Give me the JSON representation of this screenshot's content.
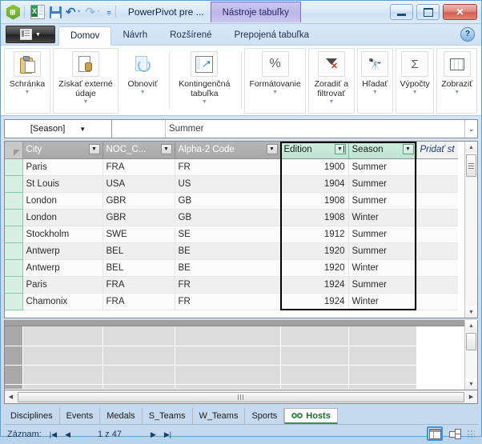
{
  "titlebar": {
    "app_title": "PowerPivot pre ...",
    "context_tab": "Nástroje tabuľky",
    "icons": {
      "powerpivot": "powerpivot-logo-icon",
      "excel": "excel-icon",
      "save": "save-icon",
      "undo": "undo-icon",
      "redo": "redo-icon",
      "qat_more": "quick-access-toolbar-more-icon"
    },
    "window_controls": {
      "minimize": "minimize-icon",
      "maximize": "maximize-icon",
      "close": "✕"
    }
  },
  "ribbon": {
    "file_button": "file-menu-button",
    "tabs": [
      {
        "label": "Domov",
        "active": true
      },
      {
        "label": "Návrh",
        "active": false
      },
      {
        "label": "Rozšírené",
        "active": false
      },
      {
        "label": "Prepojená tabuľka",
        "active": false
      }
    ],
    "help": "?",
    "groups": [
      {
        "label": "Schránka",
        "icon": "clipboard-icon",
        "has_caret": true
      },
      {
        "label": "Získať externé údaje",
        "icon": "get-external-data-icon",
        "has_caret": true
      },
      {
        "label": "Obnoviť",
        "icon": "refresh-icon",
        "has_caret": true
      },
      {
        "label": "Kontingenčná tabuľka",
        "icon": "pivot-table-icon",
        "has_caret": true
      },
      {
        "label": "Formátovanie",
        "icon": "percent-icon",
        "has_caret": true
      },
      {
        "label": "Zoradiť a filtrovať",
        "icon": "clear-filter-icon",
        "has_caret": true
      },
      {
        "label": "Hľadať",
        "icon": "binoculars-icon",
        "has_caret": true
      },
      {
        "label": "Výpočty",
        "icon": "autosum-sigma-icon",
        "has_caret": true
      },
      {
        "label": "Zobraziť",
        "icon": "view-grid-icon",
        "has_caret": true
      }
    ]
  },
  "formula_bar": {
    "name_box": "[Season]",
    "name_box_caret": "▼",
    "value": "Summer",
    "expand": "⌄"
  },
  "table": {
    "columns": [
      {
        "label": "City",
        "selected": false,
        "sorted": false,
        "align": "left"
      },
      {
        "label": "NOC_C...",
        "selected": false,
        "sorted": false,
        "align": "left"
      },
      {
        "label": "Alpha-2 Code",
        "selected": false,
        "sorted": false,
        "align": "left"
      },
      {
        "label": "Edition",
        "selected": true,
        "sorted": true,
        "align": "right"
      },
      {
        "label": "Season",
        "selected": true,
        "sorted": false,
        "align": "left"
      }
    ],
    "add_column_label": "Pridať st",
    "rows": [
      {
        "City": "Paris",
        "NOC_C": "FRA",
        "Alpha2": "FR",
        "Edition": "1900",
        "Season": "Summer"
      },
      {
        "City": "St Louis",
        "NOC_C": "USA",
        "Alpha2": "US",
        "Edition": "1904",
        "Season": "Summer"
      },
      {
        "City": "London",
        "NOC_C": "GBR",
        "Alpha2": "GB",
        "Edition": "1908",
        "Season": "Summer"
      },
      {
        "City": "London",
        "NOC_C": "GBR",
        "Alpha2": "GB",
        "Edition": "1908",
        "Season": "Winter"
      },
      {
        "City": "Stockholm",
        "NOC_C": "SWE",
        "Alpha2": "SE",
        "Edition": "1912",
        "Season": "Summer"
      },
      {
        "City": "Antwerp",
        "NOC_C": "BEL",
        "Alpha2": "BE",
        "Edition": "1920",
        "Season": "Summer"
      },
      {
        "City": "Antwerp",
        "NOC_C": "BEL",
        "Alpha2": "BE",
        "Edition": "1920",
        "Season": "Winter"
      },
      {
        "City": "Paris",
        "NOC_C": "FRA",
        "Alpha2": "FR",
        "Edition": "1924",
        "Season": "Summer"
      },
      {
        "City": "Chamonix",
        "NOC_C": "FRA",
        "Alpha2": "FR",
        "Edition": "1924",
        "Season": "Winter"
      }
    ]
  },
  "measure_grid": {
    "row_count": 4,
    "column_count": 5
  },
  "sheet_tabs": [
    {
      "label": "Disciplines",
      "active": false,
      "icon": null
    },
    {
      "label": "Events",
      "active": false,
      "icon": null
    },
    {
      "label": "Medals",
      "active": false,
      "icon": null
    },
    {
      "label": "S_Teams",
      "active": false,
      "icon": null
    },
    {
      "label": "W_Teams",
      "active": false,
      "icon": null
    },
    {
      "label": "Sports",
      "active": false,
      "icon": null
    },
    {
      "label": "Hosts",
      "active": true,
      "icon": "linked-table-icon"
    }
  ],
  "status_bar": {
    "record_label": "Záznam:",
    "first": "|◀",
    "prev": "◀",
    "position": "1 z 47",
    "next": "▶",
    "last": "▶|",
    "view_data": "data-view-icon",
    "view_diagram": "diagram-view-icon",
    "resizer": "resize-grip-icon"
  },
  "colors": {
    "accent_blue": "#3f93d8",
    "selection_green": "#bfe6d2",
    "context_tab_purple": "#bdb6e8",
    "close_red": "#cf5f51",
    "tab_active_green": "#1e6b2e"
  }
}
